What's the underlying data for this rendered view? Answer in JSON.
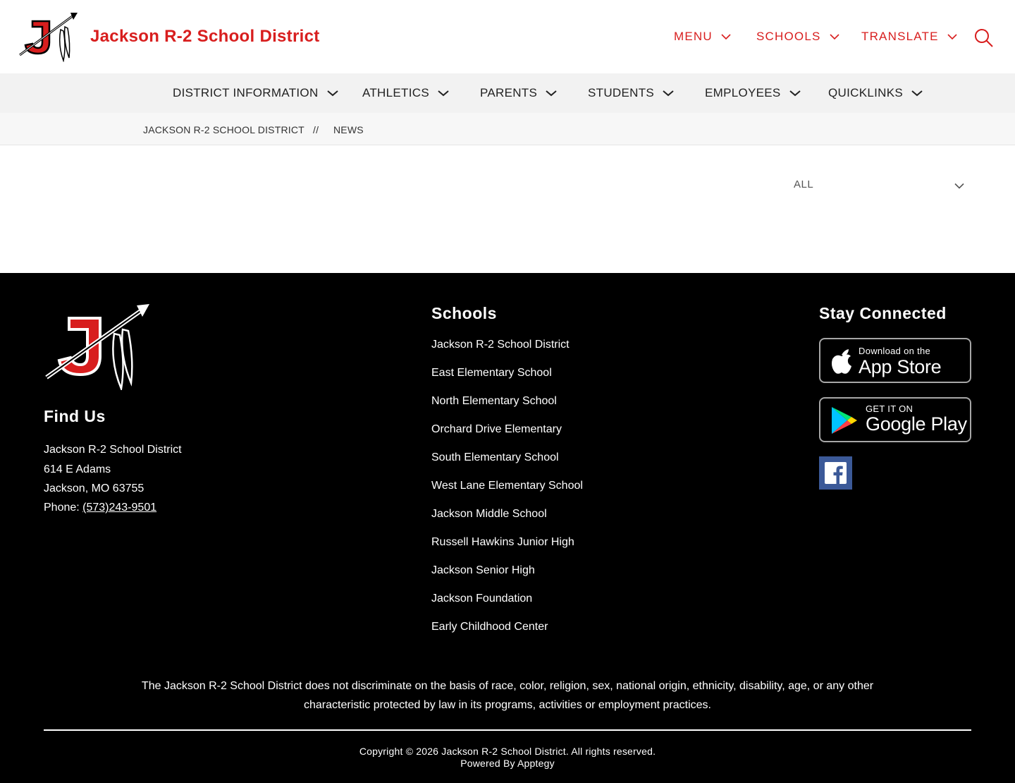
{
  "header": {
    "site_title": "Jackson R-2 School District",
    "logo_icon": "jackson-j-arrow-logo",
    "top_nav": [
      {
        "label": "MENU"
      },
      {
        "label": "SCHOOLS"
      },
      {
        "label": "TRANSLATE"
      }
    ],
    "search_icon": "search-icon",
    "brand_color": "#d81e1e"
  },
  "main_nav": [
    {
      "label": "DISTRICT INFORMATION"
    },
    {
      "label": "ATHLETICS"
    },
    {
      "label": "PARENTS"
    },
    {
      "label": "STUDENTS"
    },
    {
      "label": "EMPLOYEES"
    },
    {
      "label": "QUICKLINKS"
    }
  ],
  "breadcrumb": {
    "home": "JACKSON R-2 SCHOOL DISTRICT",
    "separator": "//",
    "current": "NEWS"
  },
  "filter": {
    "selected": "ALL"
  },
  "footer": {
    "find_us": {
      "heading": "Find Us",
      "name": "Jackson R-2 School District",
      "street": "614 E Adams",
      "city": "Jackson, MO 63755",
      "phone_label": "Phone: ",
      "phone": "(573)243-9501"
    },
    "schools": {
      "heading": "Schools",
      "items": [
        "Jackson R-2 School District",
        "East Elementary School",
        "North Elementary School",
        "Orchard Drive Elementary",
        "South Elementary School",
        "West Lane Elementary School",
        "Jackson Middle School",
        "Russell Hawkins Junior High",
        "Jackson Senior High",
        "Jackson Foundation",
        "Early Childhood Center"
      ]
    },
    "stay_connected": {
      "heading": "Stay Connected",
      "app_store_small": "Download on the",
      "app_store_big": "App Store",
      "google_play_small": "GET IT ON",
      "google_play_big": "Google Play",
      "social_icon": "facebook-icon",
      "facebook_color": "#3b5998"
    },
    "disclaimer": "The Jackson R-2 School District does not discriminate on the basis of race, color, religion, sex, national origin, ethnicity, disability, age, or any other characteristic protected by law in its programs, activities or employment practices.",
    "copyright": "Copyright © 2026 Jackson R-2 School District. All rights reserved.",
    "powered_by": "Powered By Apptegy"
  }
}
